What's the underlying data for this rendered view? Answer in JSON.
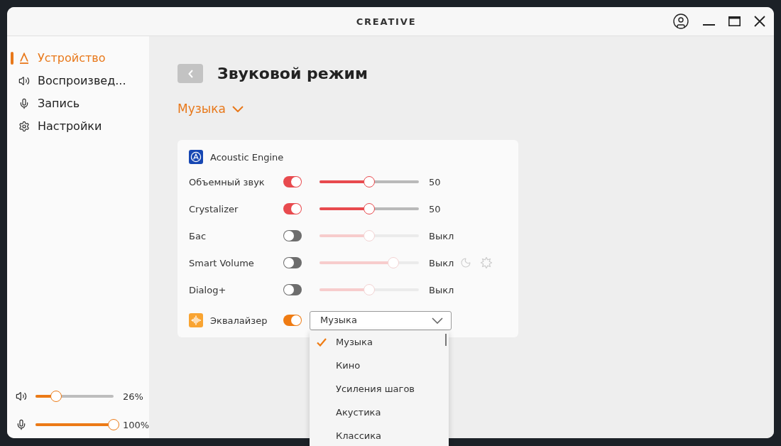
{
  "window": {
    "logo": "CREATIVE"
  },
  "sidebar": {
    "items": [
      {
        "kind": "device",
        "label": "Устройство",
        "selected": true
      },
      {
        "kind": "playback",
        "label": "Воспроизвед...",
        "selected": false
      },
      {
        "kind": "recording",
        "label": "Запись",
        "selected": false
      },
      {
        "kind": "settings",
        "label": "Настройки",
        "selected": false
      }
    ],
    "levels": [
      {
        "kind": "speaker",
        "level": 0.26,
        "reading": "26%"
      },
      {
        "kind": "microphone",
        "level": 1,
        "reading": "100%"
      }
    ]
  },
  "main": {
    "title": "Звуковой режим",
    "mode": "Музыка"
  },
  "acoustic_engine": {
    "title": "Acoustic Engine",
    "effects": [
      {
        "kind": "slider",
        "label": "Объемный звук",
        "on": true,
        "level": 0.5,
        "reading": "50"
      },
      {
        "kind": "slider",
        "label": "Crystalizer",
        "on": true,
        "level": 0.5,
        "reading": "50"
      },
      {
        "kind": "slider",
        "label": "Бас",
        "on": false,
        "level": 0.5,
        "reading": "Выкл"
      },
      {
        "kind": "night",
        "label": "Smart Volume",
        "on": false,
        "level": 0.74,
        "reading": "Выкл"
      },
      {
        "kind": "slider",
        "label": "Dialog+",
        "on": false,
        "level": 0.5,
        "reading": "Выкл"
      }
    ],
    "equalizer": {
      "label": "Эквалайзер",
      "on": true,
      "preset": "Музыка",
      "options": [
        {
          "label": "Музыка",
          "selected": true
        },
        {
          "label": "Кино",
          "selected": false
        },
        {
          "label": "Усиления шагов",
          "selected": false
        },
        {
          "label": "Акустика",
          "selected": false
        },
        {
          "label": "Классика",
          "selected": false
        }
      ]
    }
  }
}
